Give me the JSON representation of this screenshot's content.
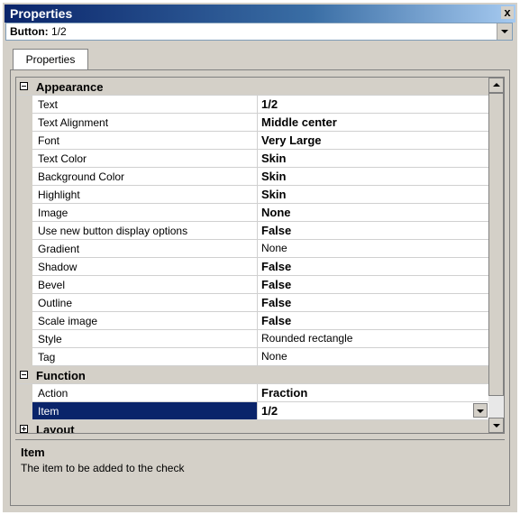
{
  "window": {
    "title": "Properties",
    "close_glyph": "x"
  },
  "selector": {
    "label": "Button:",
    "value": "1/2"
  },
  "tabs": [
    {
      "label": "Properties"
    }
  ],
  "grid": {
    "categories": [
      {
        "name": "Appearance",
        "expanded": true
      },
      {
        "name": "Function",
        "expanded": true
      },
      {
        "name": "Layout",
        "expanded": false
      }
    ],
    "appearance": [
      {
        "name": "Text",
        "value": "1/2"
      },
      {
        "name": "Text Alignment",
        "value": "Middle center"
      },
      {
        "name": "Font",
        "value": "Very Large"
      },
      {
        "name": "Text Color",
        "value": "Skin"
      },
      {
        "name": "Background Color",
        "value": "Skin"
      },
      {
        "name": "Highlight",
        "value": "Skin"
      },
      {
        "name": "Image",
        "value": "None"
      },
      {
        "name": "Use new button display options",
        "value": "False"
      },
      {
        "name": "Gradient",
        "value": "None"
      },
      {
        "name": "Shadow",
        "value": "False"
      },
      {
        "name": "Bevel",
        "value": "False"
      },
      {
        "name": "Outline",
        "value": "False"
      },
      {
        "name": "Scale image",
        "value": "False"
      },
      {
        "name": "Style",
        "value": "Rounded rectangle"
      },
      {
        "name": "Tag",
        "value": "None"
      }
    ],
    "function": [
      {
        "name": "Action",
        "value": "Fraction"
      },
      {
        "name": "Item",
        "value": "1/2",
        "selected": true
      }
    ]
  },
  "description": {
    "title": "Item",
    "text": "The item to be added to the check"
  },
  "colors": {
    "titlebar": "#0a246a",
    "selection": "#0a246a",
    "chrome": "#d4d0c8"
  }
}
